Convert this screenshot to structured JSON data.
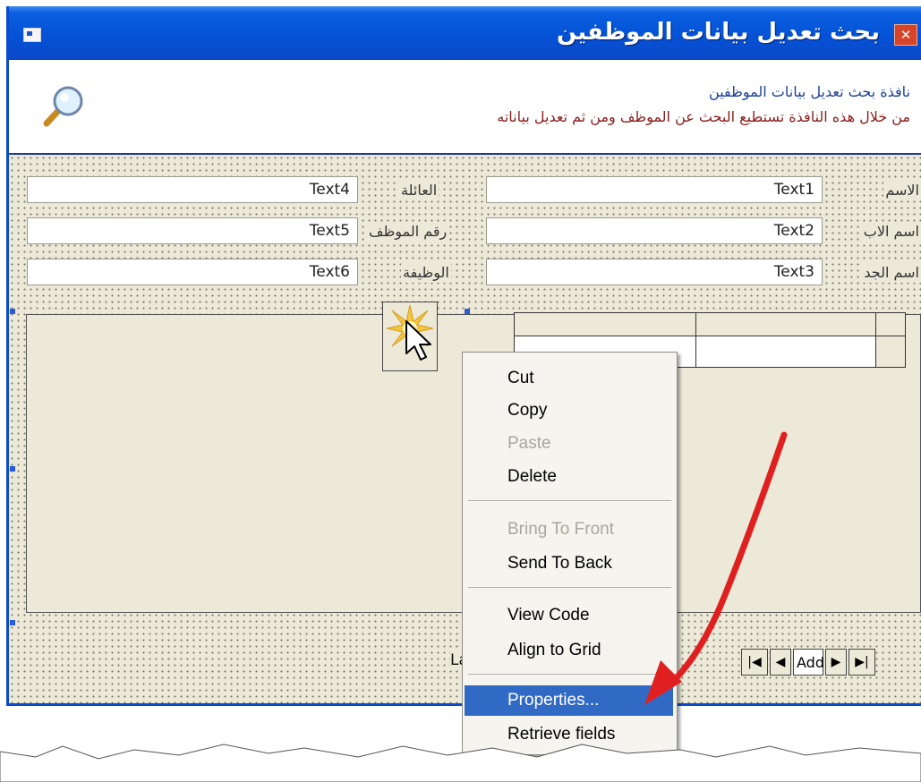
{
  "window": {
    "title": "بحث تعديل بيانات الموظفين",
    "info_line1": "نافذة بحث تعديل بيانات الموظفين",
    "info_line2": "من خلال هذه النافذة تستطيع البحث عن الموظف ومن ثم تعديل بياناته"
  },
  "icons": {
    "magnifier": "magnifier-icon",
    "window": "window-icon",
    "title": "app-icon"
  },
  "fields": {
    "text1": "Text1",
    "text2": "Text2",
    "text3": "Text3",
    "text4": "Text4",
    "text5": "Text5",
    "text6": "Text6"
  },
  "labels": {
    "name": "الاسم",
    "father": "اسم الاب",
    "grandfather": "اسم الجد",
    "family": "العائلة",
    "employee_no": "رقم الموظف",
    "job": "الوظيفة"
  },
  "nav": {
    "label": "La",
    "first": "|◀",
    "prev": "◀",
    "text": "Add",
    "next": "▶",
    "last": "▶|"
  },
  "context_menu": {
    "items": [
      "Cut",
      "Copy",
      "Paste",
      "Delete",
      "Bring To Front",
      "Send To Back",
      "View Code",
      "Align to Grid",
      "Properties...",
      "Retrieve fields"
    ],
    "disabled": [
      "Paste",
      "Bring To Front"
    ],
    "selected": "Properties..."
  },
  "colors": {
    "titlebar": "#0552d6",
    "menu_highlight": "#316ac5",
    "arrow": "#e02020",
    "form_bg": "#ece9d8"
  }
}
